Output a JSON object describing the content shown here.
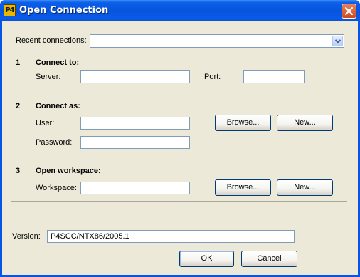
{
  "window": {
    "title": "Open Connection",
    "icon": "p4-app-icon",
    "icon_text": "P4"
  },
  "recent": {
    "label": "Recent connections:",
    "value": ""
  },
  "connect_to": {
    "number": "1",
    "heading": "Connect to:",
    "server_label": "Server:",
    "server_value": "",
    "port_label": "Port:",
    "port_value": ""
  },
  "connect_as": {
    "number": "2",
    "heading": "Connect as:",
    "user_label": "User:",
    "user_value": "",
    "browse_label": "Browse...",
    "new_label": "New...",
    "password_label": "Password:",
    "password_value": ""
  },
  "workspace": {
    "number": "3",
    "heading": "Open workspace:",
    "workspace_label": "Workspace:",
    "workspace_value": "",
    "browse_label": "Browse...",
    "new_label": "New..."
  },
  "version": {
    "label": "Version:",
    "value": "P4SCC/NTX86/2005.1"
  },
  "buttons": {
    "ok": "OK",
    "cancel": "Cancel"
  }
}
